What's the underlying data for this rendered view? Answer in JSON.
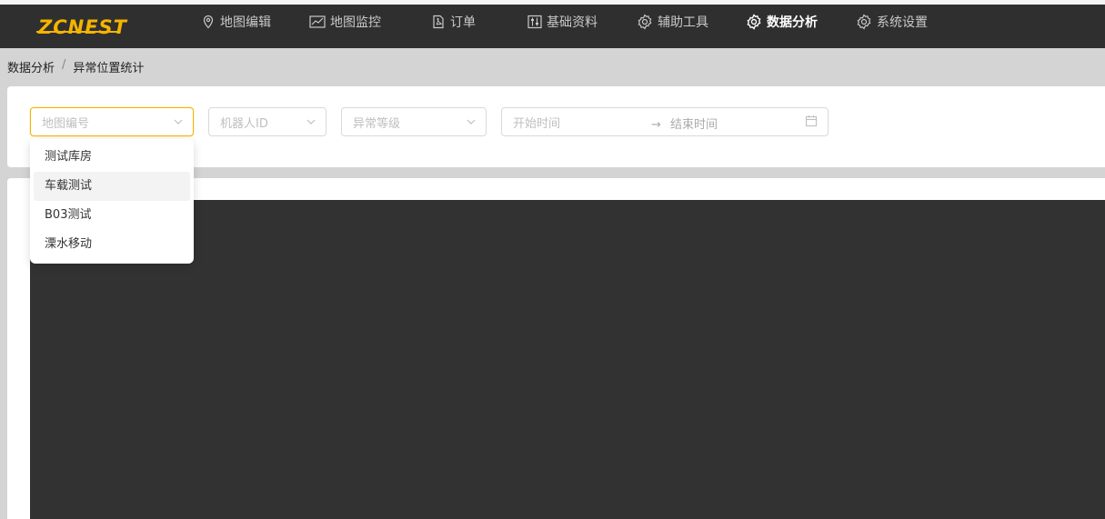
{
  "brand": {
    "logo_text": "ZCNEST",
    "accent_color": "#f5b400"
  },
  "nav": {
    "items": [
      {
        "label": "地图编辑",
        "icon": "location-pin-icon"
      },
      {
        "label": "地图监控",
        "icon": "chart-line-icon"
      },
      {
        "label": "订单",
        "icon": "document-icon"
      },
      {
        "label": "基础资料",
        "icon": "sliders-icon"
      },
      {
        "label": "辅助工具",
        "icon": "gear-icon"
      },
      {
        "label": "数据分析",
        "icon": "gear-icon",
        "active": true
      },
      {
        "label": "系统设置",
        "icon": "gear-icon"
      }
    ]
  },
  "breadcrumb": {
    "parent": "数据分析",
    "separator": "/",
    "current": "异常位置统计"
  },
  "filters": {
    "map_select": {
      "placeholder": "地图编号"
    },
    "robot_select": {
      "placeholder": "机器人ID"
    },
    "level_select": {
      "placeholder": "异常等级"
    },
    "date_range": {
      "start_placeholder": "开始时间",
      "separator": "→",
      "end_placeholder": "结束时间"
    }
  },
  "dropdown": {
    "options": [
      "测试库房",
      "车载测试",
      "B03测试",
      "溧水移动"
    ],
    "hover_index": 1
  }
}
